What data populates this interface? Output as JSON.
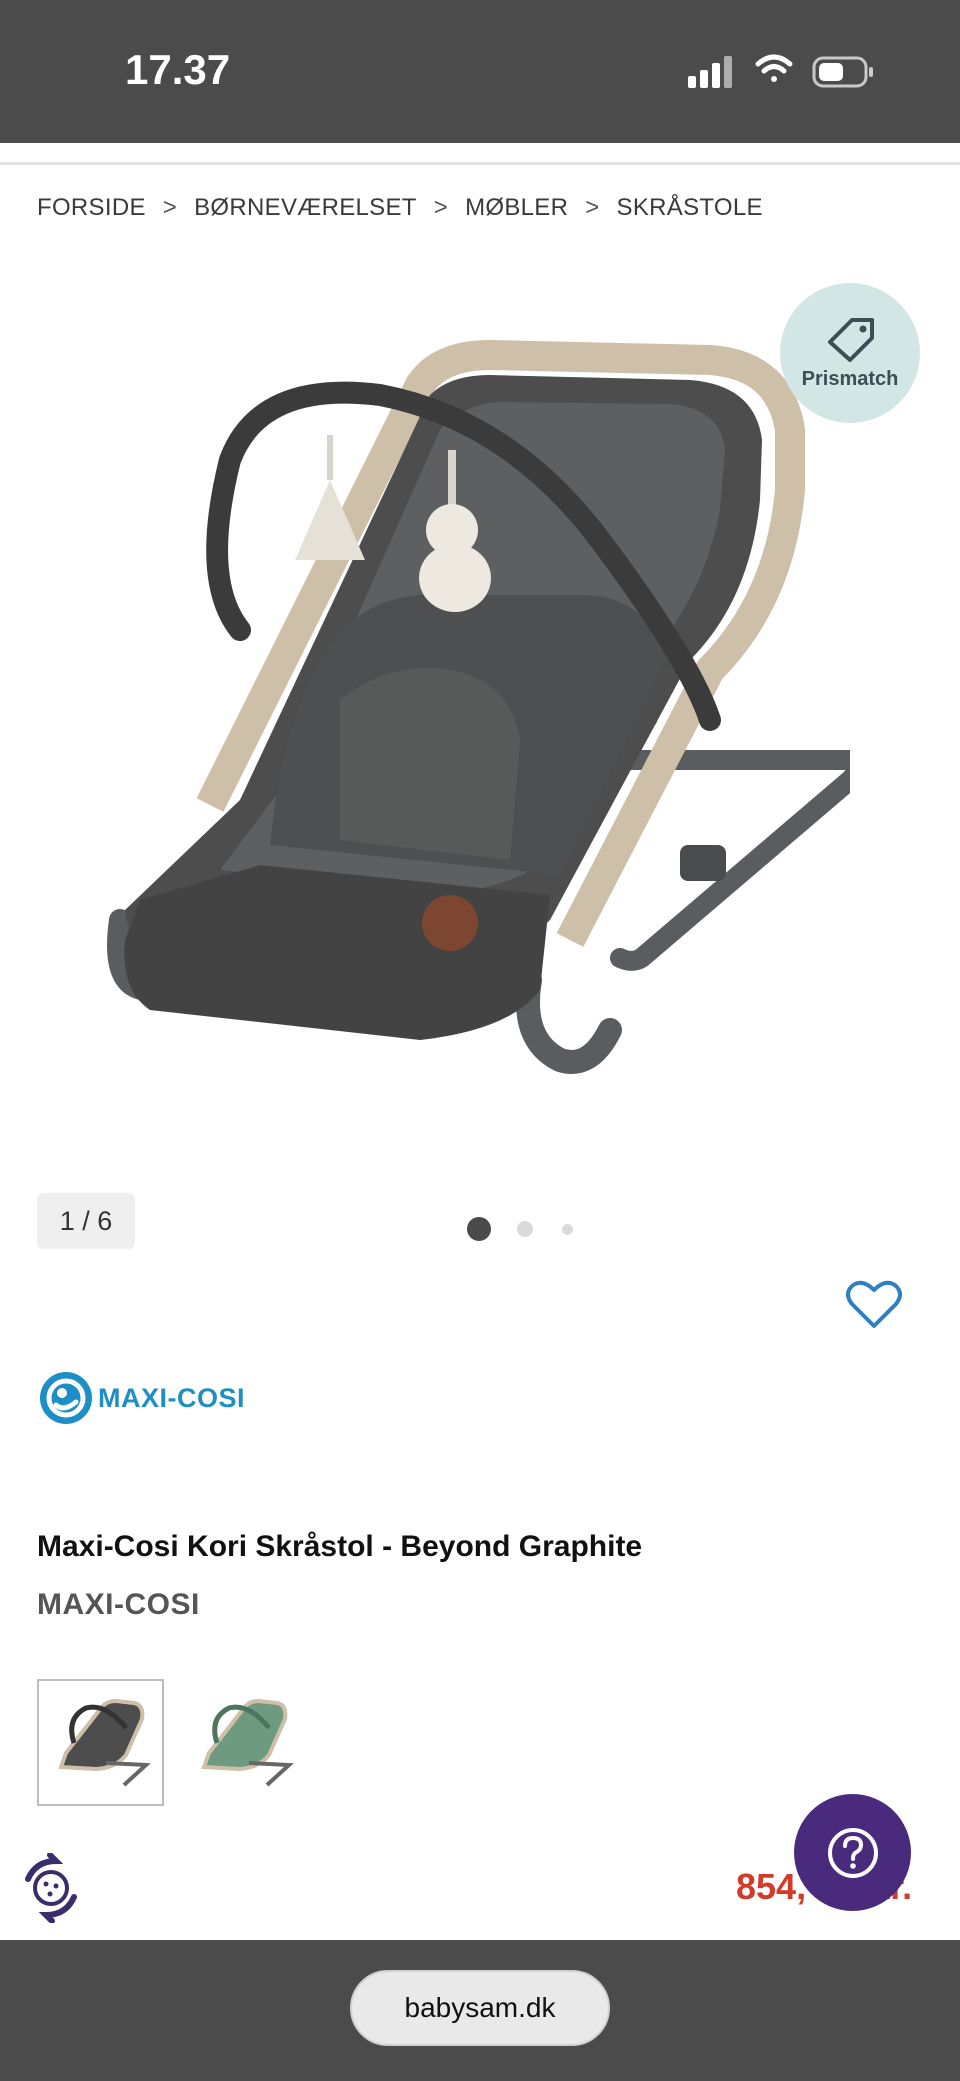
{
  "status_bar": {
    "time": "17.37",
    "icons": [
      "signal-icon",
      "wifi-icon",
      "battery-icon"
    ]
  },
  "breadcrumb": {
    "items": [
      "FORSIDE",
      "BØRNEVÆRELSET",
      "MØBLER",
      "SKRÅSTOLE"
    ],
    "separator": ">"
  },
  "gallery": {
    "badge_label": "Prismatch",
    "counter": "1 / 6",
    "active_dot": 1
  },
  "product": {
    "brand_logo_text": "MAXI-COSI",
    "title": "Maxi-Cosi Kori Skråstol - Beyond Graphite",
    "brand": "MAXI-COSI",
    "price": "854,",
    "price_suffix": "kr.",
    "variants": [
      "Beyond Graphite",
      "Beyond Green"
    ]
  },
  "browser": {
    "url": "babysam.dk"
  },
  "colors": {
    "status_bar_bg": "#4b4b4b",
    "price": "#d23a2a",
    "brand_blue": "#1d8fc6",
    "help_button": "#4a2a7c",
    "wishlist": "#2f7fc1",
    "prismatch_bg": "#d3e6e6"
  }
}
